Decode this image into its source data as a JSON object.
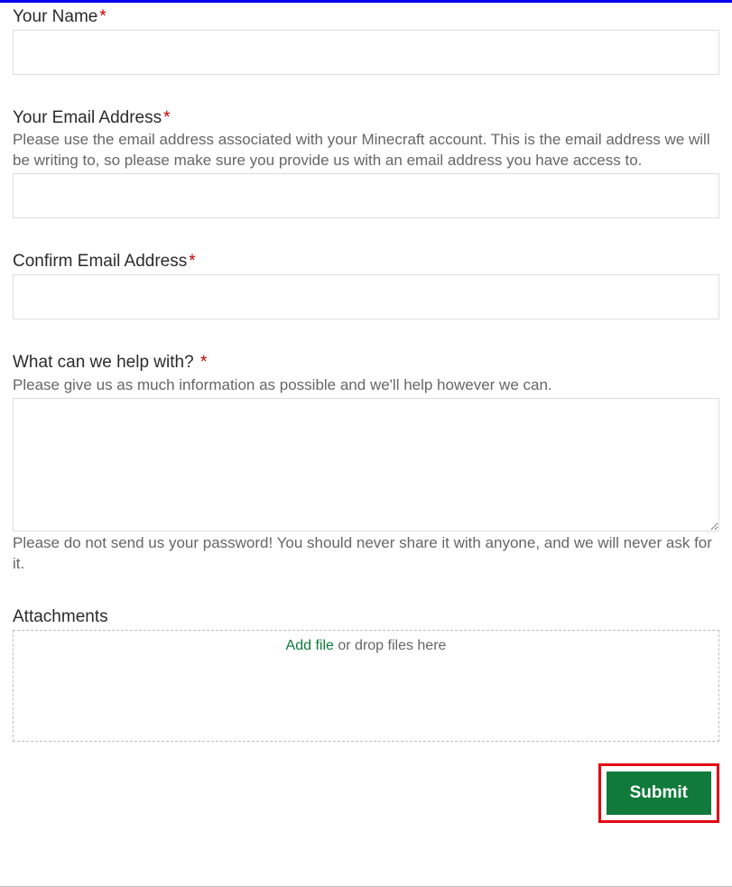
{
  "fields": {
    "name": {
      "label": "Your Name",
      "required": "*"
    },
    "email": {
      "label": "Your Email Address",
      "required": "*",
      "hint": "Please use the email address associated with your Minecraft account. This is the email address we will be writing to, so please make sure you provide us with an email address you have access to."
    },
    "confirmEmail": {
      "label": "Confirm Email Address",
      "required": "*"
    },
    "help": {
      "label": "What can we help with? ",
      "required": "*",
      "hint": "Please give us as much information as possible and we'll help however we can.",
      "hintBelow": "Please do not send us your password! You should never share it with anyone, and we will never ask for it."
    },
    "attachments": {
      "label": "Attachments",
      "addFile": "Add file",
      "dropText": " or drop files here"
    }
  },
  "submit": "Submit"
}
